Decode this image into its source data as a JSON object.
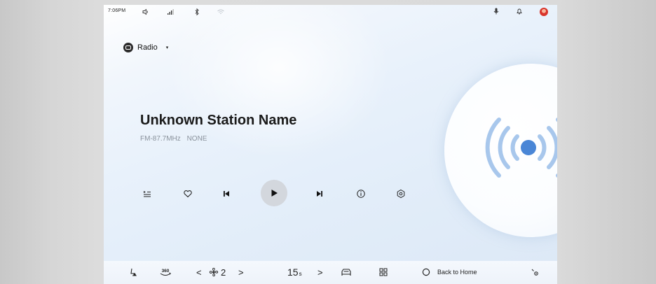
{
  "status_bar": {
    "time": "7:06PM",
    "icons": [
      "volume-icon",
      "signal-icon",
      "bluetooth-icon",
      "wifi-icon",
      "mic-icon",
      "bell-icon",
      "avatar"
    ]
  },
  "source": {
    "label": "Radio",
    "icon": "radio-source-icon",
    "caret": "▾"
  },
  "station": {
    "name": "Unknown Station Name",
    "frequency": "FM-87.7MHz",
    "rds": "NONE"
  },
  "controls": {
    "items": [
      "playlist-icon",
      "favorite-icon",
      "previous-icon",
      "play-icon",
      "next-icon",
      "info-icon",
      "settings-icon"
    ]
  },
  "dock": {
    "fan_left": "<",
    "fan_level": "2",
    "fan_right": ">",
    "seat_value": "15",
    "seat_unit": "s",
    "seat_right": ">",
    "home_label": "Back to Home"
  },
  "colors": {
    "accent": "#4a86d6",
    "waves": "#a8c7ec",
    "text": "#1a1a1a",
    "subtext": "#8a929c"
  }
}
